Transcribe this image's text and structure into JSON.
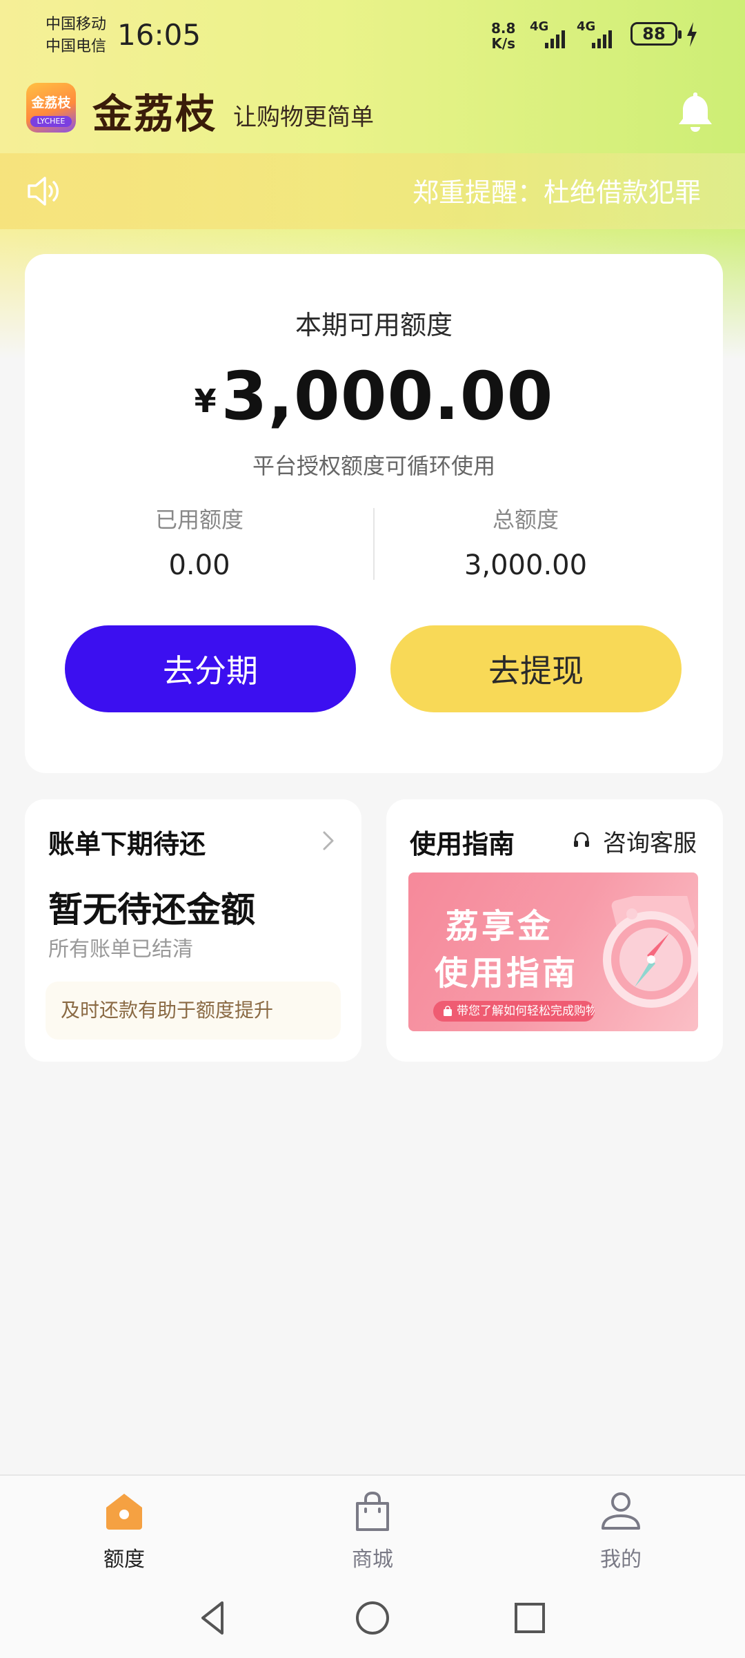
{
  "status": {
    "carrier1": "中国移动",
    "carrier2": "中国电信",
    "time": "16:05",
    "net_speed_value": "8.8",
    "net_speed_unit": "K/s",
    "sim1_type": "4G",
    "sim2_type": "4G",
    "battery": "88"
  },
  "header": {
    "logo_text": "金荔枝",
    "logo_sub": "LYCHEE",
    "app_name": "金荔枝",
    "slogan": "让购物更简单"
  },
  "notice": {
    "text": "郑重提醒：杜绝借款犯罪"
  },
  "quota": {
    "title": "本期可用额度",
    "currency": "¥",
    "amount": "3,000.00",
    "subtitle": "平台授权额度可循环使用",
    "used_label": "已用额度",
    "used_value": "0.00",
    "total_label": "总额度",
    "total_value": "3,000.00",
    "installment_button": "去分期",
    "withdraw_button": "去提现"
  },
  "bill": {
    "title": "账单下期待还",
    "status": "暂无待还金额",
    "sub": "所有账单已结清",
    "tip": "及时还款有助于额度提升"
  },
  "guide": {
    "title": "使用指南",
    "service_label": "咨询客服",
    "banner_line1": "荔享金",
    "banner_line2": "使用指南",
    "banner_pill": "带您了解如何轻松完成购物"
  },
  "nav": {
    "items": [
      {
        "label": "额度",
        "icon": "home-icon",
        "active": true
      },
      {
        "label": "商城",
        "icon": "shopping-bag-icon",
        "active": false
      },
      {
        "label": "我的",
        "icon": "user-icon",
        "active": false
      }
    ]
  },
  "colors": {
    "primary_button": "#3c0ff0",
    "secondary_button": "#f8d957",
    "nav_active": "#f5a142"
  }
}
